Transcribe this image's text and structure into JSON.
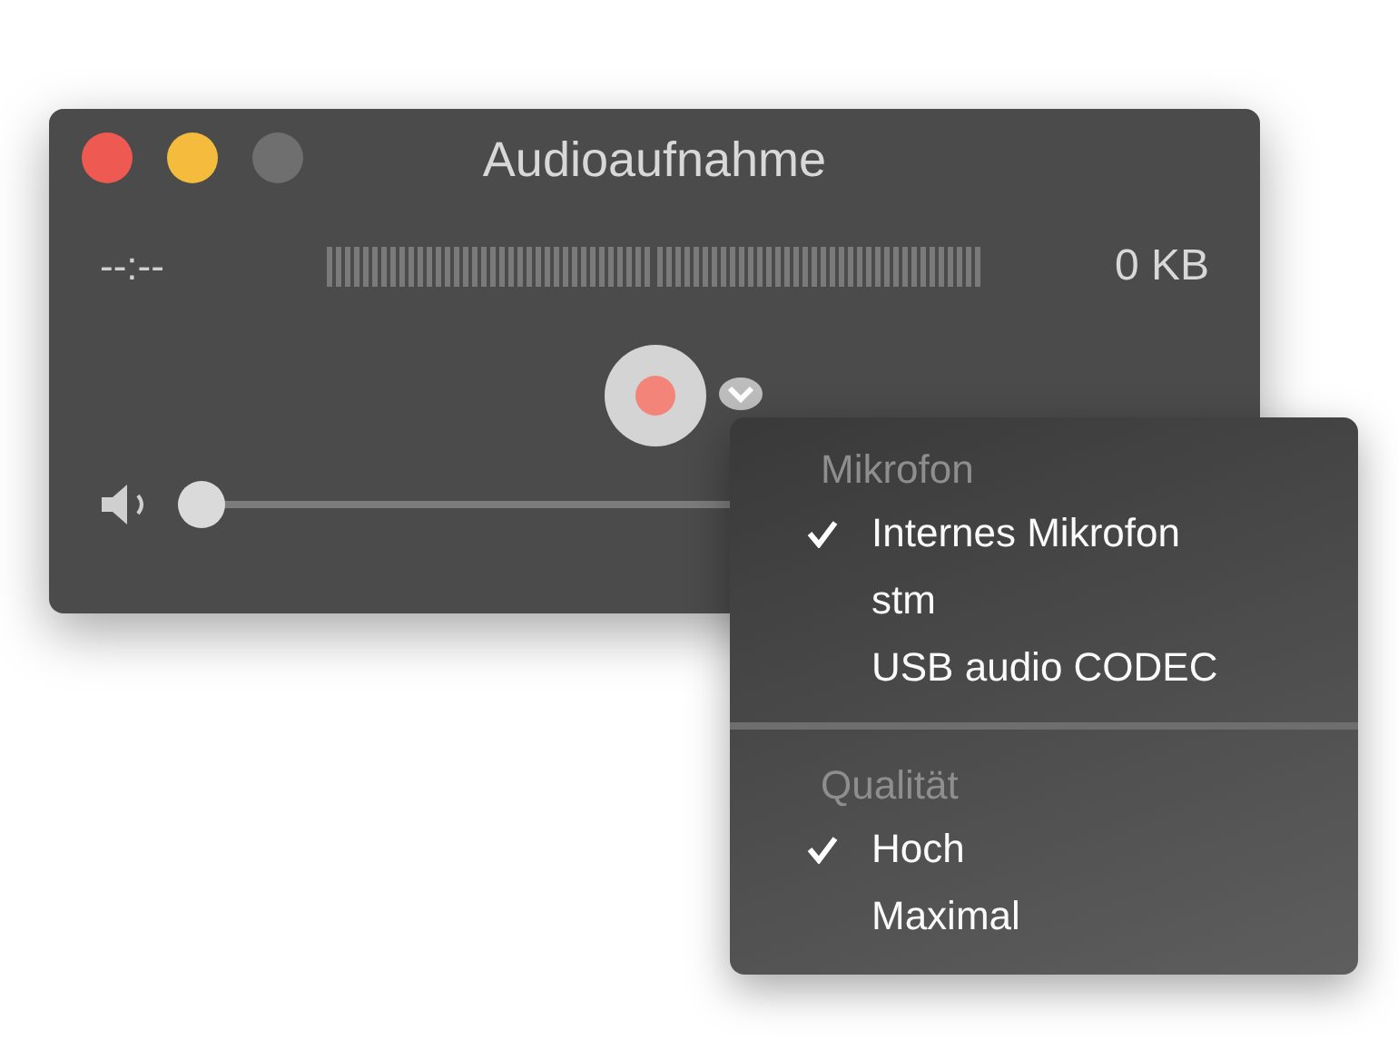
{
  "window": {
    "title": "Audioaufnahme"
  },
  "recording": {
    "time": "--:--",
    "size": "0 KB"
  },
  "volume": {
    "level": 0.0
  },
  "menu": {
    "sections": [
      {
        "header": "Mikrofon",
        "items": [
          {
            "label": "Internes Mikrofon",
            "selected": true
          },
          {
            "label": "stm",
            "selected": false
          },
          {
            "label": "USB audio CODEC",
            "selected": false
          }
        ]
      },
      {
        "header": "Qualität",
        "items": [
          {
            "label": "Hoch",
            "selected": true
          },
          {
            "label": "Maximal",
            "selected": false
          }
        ]
      }
    ]
  }
}
